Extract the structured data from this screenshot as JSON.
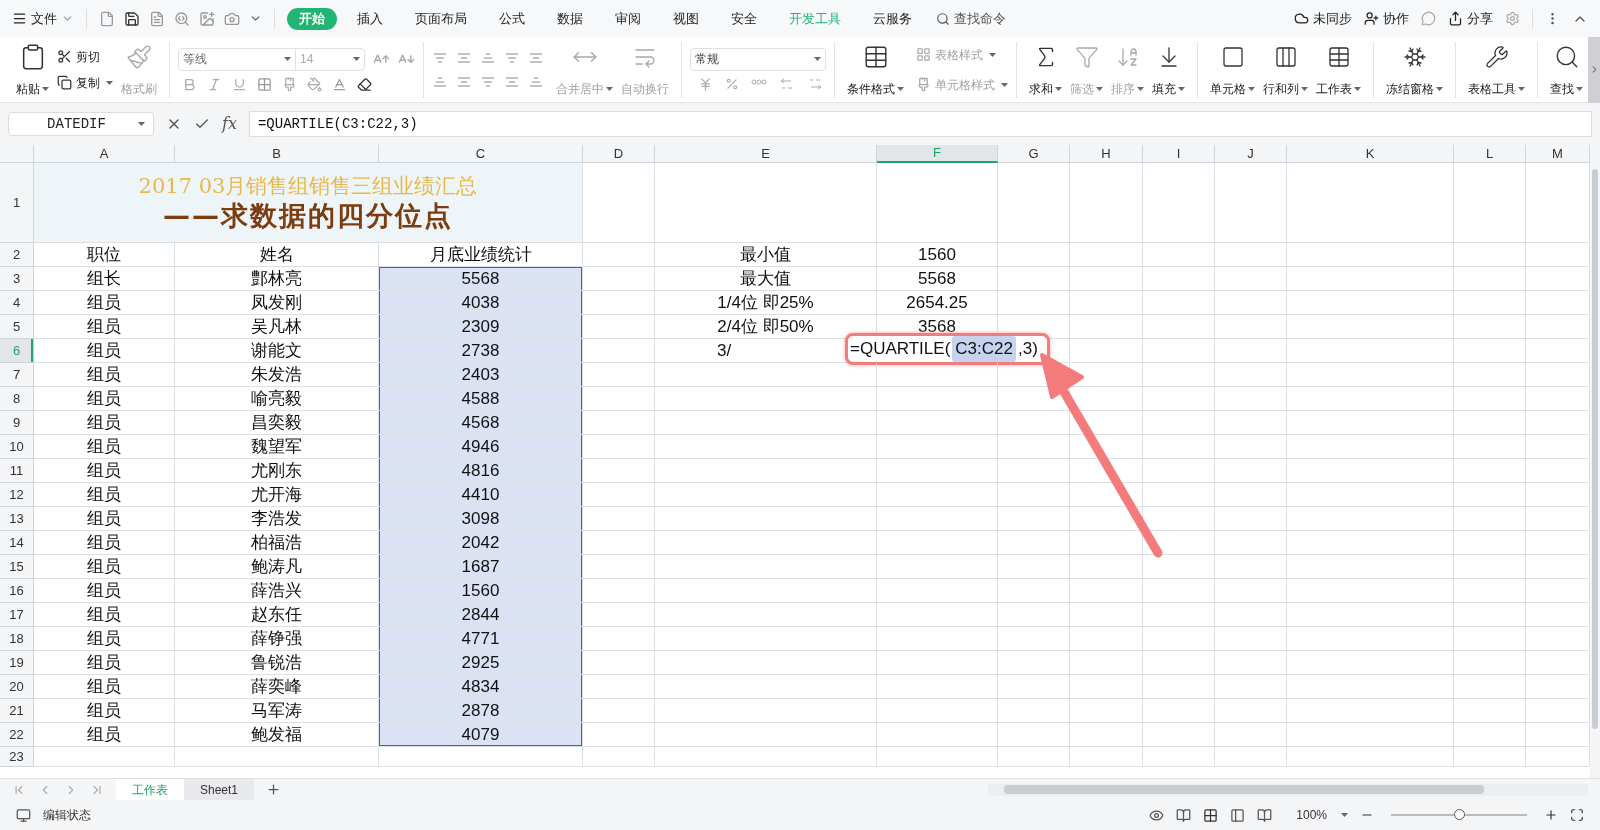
{
  "menu": {
    "file": "文件",
    "search": "查找命令"
  },
  "tabs": [
    {
      "label": "开始",
      "selected": true,
      "accent": false
    },
    {
      "label": "插入",
      "selected": false,
      "accent": false
    },
    {
      "label": "页面布局",
      "selected": false,
      "accent": false
    },
    {
      "label": "公式",
      "selected": false,
      "accent": false
    },
    {
      "label": "数据",
      "selected": false,
      "accent": false
    },
    {
      "label": "审阅",
      "selected": false,
      "accent": false
    },
    {
      "label": "视图",
      "selected": false,
      "accent": false
    },
    {
      "label": "安全",
      "selected": false,
      "accent": false
    },
    {
      "label": "开发工具",
      "selected": false,
      "accent": true
    },
    {
      "label": "云服务",
      "selected": false,
      "accent": false
    }
  ],
  "top_actions": {
    "sync": "未同步",
    "collab": "协作",
    "share": "分享"
  },
  "ribbon": {
    "paste": {
      "label": "粘贴",
      "disabled": false,
      "dropdown": true
    },
    "cut": {
      "label": "剪切",
      "disabled": false,
      "dropdown": false
    },
    "copy": {
      "label": "复制",
      "disabled": false,
      "dropdown": true
    },
    "format_painter": {
      "label": "格式刷",
      "disabled": true,
      "dropdown": false
    },
    "font_name": "等线",
    "font_size": "14",
    "number_format": "常规",
    "merge": {
      "label": "合并居中",
      "disabled": true,
      "dropdown": true
    },
    "wrap": {
      "label": "自动换行",
      "disabled": true,
      "dropdown": false
    },
    "cond_format": {
      "label": "条件格式",
      "disabled": false,
      "dropdown": true
    },
    "table_style": {
      "label": "表格样式",
      "disabled": true,
      "dropdown": true
    },
    "cell_style": {
      "label": "单元格样式",
      "disabled": true,
      "dropdown": true
    },
    "sum": {
      "label": "求和",
      "disabled": false,
      "dropdown": true
    },
    "filter": {
      "label": "筛选",
      "disabled": true,
      "dropdown": true
    },
    "sort": {
      "label": "排序",
      "disabled": true,
      "dropdown": true
    },
    "fill": {
      "label": "填充",
      "disabled": false,
      "dropdown": true
    },
    "cells": {
      "label": "单元格",
      "disabled": false,
      "dropdown": true
    },
    "rows_cols": {
      "label": "行和列",
      "disabled": false,
      "dropdown": true
    },
    "worksheet": {
      "label": "工作表",
      "disabled": false,
      "dropdown": true
    },
    "freeze": {
      "label": "冻结窗格",
      "disabled": false,
      "dropdown": true
    },
    "table_tools": {
      "label": "表格工具",
      "disabled": false,
      "dropdown": true
    },
    "find": {
      "label": "查找",
      "disabled": false,
      "dropdown": true
    }
  },
  "formula_bar": {
    "name_box": "DATEDIF",
    "fx": "fx",
    "formula": "=QUARTILE(C3:C22,3)"
  },
  "columns": [
    {
      "label": "A",
      "selected": false,
      "in_range": false
    },
    {
      "label": "B",
      "selected": false,
      "in_range": false
    },
    {
      "label": "C",
      "selected": false,
      "in_range": true
    },
    {
      "label": "D",
      "selected": false,
      "in_range": false
    },
    {
      "label": "E",
      "selected": false,
      "in_range": false
    },
    {
      "label": "F",
      "selected": true,
      "in_range": false
    },
    {
      "label": "G",
      "selected": false,
      "in_range": false
    },
    {
      "label": "H",
      "selected": false,
      "in_range": false
    },
    {
      "label": "I",
      "selected": false,
      "in_range": false
    },
    {
      "label": "J",
      "selected": false,
      "in_range": false
    },
    {
      "label": "K",
      "selected": false,
      "in_range": false
    },
    {
      "label": "L",
      "selected": false,
      "in_range": false
    },
    {
      "label": "M",
      "selected": false,
      "in_range": false
    }
  ],
  "title": {
    "line_1": "2017 03月销售组销售三组业绩汇总",
    "line_2": "——求数据的四分位点"
  },
  "rows": [
    {
      "number": "1",
      "selected": false,
      "in_range": false,
      "cells": {}
    },
    {
      "number": "2",
      "selected": false,
      "in_range": false,
      "cells": {
        "A": "职位",
        "B": "姓名",
        "C": "月底业绩统计",
        "E": "最小值",
        "F": "1560"
      }
    },
    {
      "number": "3",
      "selected": false,
      "in_range": true,
      "cells": {
        "A": "组长",
        "B": "鄷林亮",
        "C": "5568",
        "E": "最大值",
        "F": "5568"
      }
    },
    {
      "number": "4",
      "selected": false,
      "in_range": true,
      "cells": {
        "A": "组员",
        "B": "凤发刚",
        "C": "4038",
        "E": "1/4位 即25%",
        "F": "2654.25"
      }
    },
    {
      "number": "5",
      "selected": false,
      "in_range": true,
      "cells": {
        "A": "组员",
        "B": "吴凡林",
        "C": "2309",
        "E": "2/4位 即50%",
        "F": "3568"
      }
    },
    {
      "number": "6",
      "selected": true,
      "in_range": true,
      "cells": {
        "A": "组员",
        "B": "谢能文",
        "C": "2738",
        "E": {
          "text": "3/",
          "indented": true
        }
      }
    },
    {
      "number": "7",
      "selected": false,
      "in_range": true,
      "cells": {
        "A": "组员",
        "B": "朱发浩",
        "C": "2403"
      }
    },
    {
      "number": "8",
      "selected": false,
      "in_range": true,
      "cells": {
        "A": "组员",
        "B": "喻亮毅",
        "C": "4588"
      }
    },
    {
      "number": "9",
      "selected": false,
      "in_range": true,
      "cells": {
        "A": "组员",
        "B": "昌奕毅",
        "C": "4568"
      }
    },
    {
      "number": "10",
      "selected": false,
      "in_range": true,
      "cells": {
        "A": "组员",
        "B": "魏望军",
        "C": "4946"
      }
    },
    {
      "number": "11",
      "selected": false,
      "in_range": true,
      "cells": {
        "A": "组员",
        "B": "尤刚东",
        "C": "4816"
      }
    },
    {
      "number": "12",
      "selected": false,
      "in_range": true,
      "cells": {
        "A": "组员",
        "B": "尤开海",
        "C": "4410"
      }
    },
    {
      "number": "13",
      "selected": false,
      "in_range": true,
      "cells": {
        "A": "组员",
        "B": "李浩发",
        "C": "3098"
      }
    },
    {
      "number": "14",
      "selected": false,
      "in_range": true,
      "cells": {
        "A": "组员",
        "B": "柏福浩",
        "C": "2042"
      }
    },
    {
      "number": "15",
      "selected": false,
      "in_range": true,
      "cells": {
        "A": "组员",
        "B": "鲍涛凡",
        "C": "1687"
      }
    },
    {
      "number": "16",
      "selected": false,
      "in_range": true,
      "cells": {
        "A": "组员",
        "B": "薛浩兴",
        "C": "1560"
      }
    },
    {
      "number": "17",
      "selected": false,
      "in_range": true,
      "cells": {
        "A": "组员",
        "B": "赵东任",
        "C": "2844"
      }
    },
    {
      "number": "18",
      "selected": false,
      "in_range": true,
      "cells": {
        "A": "组员",
        "B": "薛铮强",
        "C": "4771"
      }
    },
    {
      "number": "19",
      "selected": false,
      "in_range": true,
      "cells": {
        "A": "组员",
        "B": "鲁锐浩",
        "C": "2925"
      }
    },
    {
      "number": "20",
      "selected": false,
      "in_range": true,
      "cells": {
        "A": "组员",
        "B": "薛奕峰",
        "C": "4834"
      }
    },
    {
      "number": "21",
      "selected": false,
      "in_range": true,
      "cells": {
        "A": "组员",
        "B": "马军涛",
        "C": "2878"
      }
    },
    {
      "number": "22",
      "selected": false,
      "in_range": true,
      "cells": {
        "A": "组员",
        "B": "鲍发福",
        "C": "4079"
      }
    },
    {
      "number": "23",
      "selected": false,
      "in_range": false,
      "cells": {}
    }
  ],
  "editor": {
    "before": "=QUARTILE(",
    "reference": "C3:C22",
    "after": ",3)"
  },
  "sheets": [
    {
      "label": "工作表",
      "selected": true
    },
    {
      "label": "Sheet1",
      "selected": false
    }
  ],
  "status_bar": {
    "mode": "编辑状态",
    "zoom": "100%",
    "level": 0.5
  }
}
